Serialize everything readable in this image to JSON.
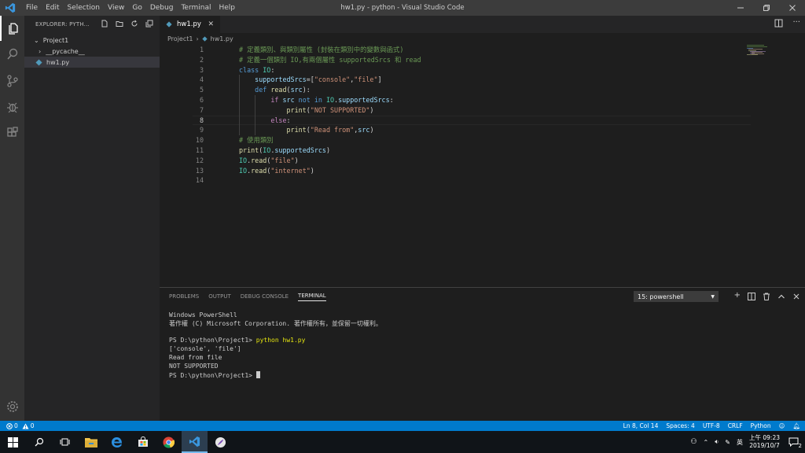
{
  "window": {
    "title": "hw1.py - python - Visual Studio Code",
    "menu": [
      "File",
      "Edit",
      "Selection",
      "View",
      "Go",
      "Debug",
      "Terminal",
      "Help"
    ]
  },
  "sidebar": {
    "header": "EXPLORER: PYTH...",
    "project": "Project1",
    "items": [
      {
        "label": "__pycache__"
      },
      {
        "label": "hw1.py"
      }
    ]
  },
  "editor": {
    "tab_label": "hw1.py",
    "breadcrumb": {
      "folder": "Project1",
      "file": "hw1.py"
    },
    "line_numbers": [
      "1",
      "2",
      "3",
      "4",
      "5",
      "6",
      "7",
      "8",
      "9",
      "10",
      "11",
      "12",
      "13",
      "14"
    ],
    "lines": [
      {
        "tokens": [
          {
            "t": "# 定義類別、與類別屬性 (封裝在類別中的變數與函式)",
            "c": "cm"
          }
        ]
      },
      {
        "tokens": [
          {
            "t": "# 定義一個類別 IO,有兩個屬性 supportedSrcs 和 read",
            "c": "cm"
          }
        ]
      },
      {
        "tokens": [
          {
            "t": "class ",
            "c": "kw"
          },
          {
            "t": "IO",
            "c": "cls"
          },
          {
            "t": ":",
            "c": "pl"
          }
        ]
      },
      {
        "tokens": [
          {
            "t": "    ",
            "c": "pl"
          },
          {
            "t": "supportedSrcs",
            "c": "var"
          },
          {
            "t": "=[",
            "c": "pl"
          },
          {
            "t": "\"console\"",
            "c": "str"
          },
          {
            "t": ",",
            "c": "pl"
          },
          {
            "t": "\"file\"",
            "c": "str"
          },
          {
            "t": "]",
            "c": "pl"
          }
        ]
      },
      {
        "tokens": [
          {
            "t": "    ",
            "c": "pl"
          },
          {
            "t": "def ",
            "c": "kw"
          },
          {
            "t": "read",
            "c": "fn"
          },
          {
            "t": "(",
            "c": "pl"
          },
          {
            "t": "src",
            "c": "var"
          },
          {
            "t": "):",
            "c": "pl"
          }
        ]
      },
      {
        "tokens": [
          {
            "t": "        ",
            "c": "pl"
          },
          {
            "t": "if ",
            "c": "ctl"
          },
          {
            "t": "src ",
            "c": "var"
          },
          {
            "t": "not in ",
            "c": "kw"
          },
          {
            "t": "IO",
            "c": "cls"
          },
          {
            "t": ".",
            "c": "pl"
          },
          {
            "t": "supportedSrcs",
            "c": "var"
          },
          {
            "t": ":",
            "c": "pl"
          }
        ]
      },
      {
        "tokens": [
          {
            "t": "            ",
            "c": "pl"
          },
          {
            "t": "print",
            "c": "fn"
          },
          {
            "t": "(",
            "c": "pl"
          },
          {
            "t": "\"NOT SUPPORTED\"",
            "c": "str"
          },
          {
            "t": ")",
            "c": "pl"
          }
        ]
      },
      {
        "tokens": [
          {
            "t": "        ",
            "c": "pl"
          },
          {
            "t": "else",
            "c": "ctl"
          },
          {
            "t": ":",
            "c": "pl"
          }
        ]
      },
      {
        "tokens": [
          {
            "t": "            ",
            "c": "pl"
          },
          {
            "t": "print",
            "c": "fn"
          },
          {
            "t": "(",
            "c": "pl"
          },
          {
            "t": "\"Read from\"",
            "c": "str"
          },
          {
            "t": ",",
            "c": "pl"
          },
          {
            "t": "src",
            "c": "var"
          },
          {
            "t": ")",
            "c": "pl"
          }
        ]
      },
      {
        "tokens": [
          {
            "t": "# 使用類別",
            "c": "cm"
          }
        ]
      },
      {
        "tokens": [
          {
            "t": "print",
            "c": "fn"
          },
          {
            "t": "(",
            "c": "pl"
          },
          {
            "t": "IO",
            "c": "cls"
          },
          {
            "t": ".",
            "c": "pl"
          },
          {
            "t": "supportedSrcs",
            "c": "var"
          },
          {
            "t": ")",
            "c": "pl"
          }
        ]
      },
      {
        "tokens": [
          {
            "t": "IO",
            "c": "cls"
          },
          {
            "t": ".",
            "c": "pl"
          },
          {
            "t": "read",
            "c": "fn"
          },
          {
            "t": "(",
            "c": "pl"
          },
          {
            "t": "\"file\"",
            "c": "str"
          },
          {
            "t": ")",
            "c": "pl"
          }
        ]
      },
      {
        "tokens": [
          {
            "t": "IO",
            "c": "cls"
          },
          {
            "t": ".",
            "c": "pl"
          },
          {
            "t": "read",
            "c": "fn"
          },
          {
            "t": "(",
            "c": "pl"
          },
          {
            "t": "\"internet\"",
            "c": "str"
          },
          {
            "t": ")",
            "c": "pl"
          }
        ]
      },
      {
        "tokens": []
      }
    ]
  },
  "panel": {
    "tabs": [
      "PROBLEMS",
      "OUTPUT",
      "DEBUG CONSOLE",
      "TERMINAL"
    ],
    "active_tab": "TERMINAL",
    "terminal_select": "15: powershell",
    "terminal": {
      "lines": [
        "Windows PowerShell",
        "著作權 (C) Microsoft Corporation. 著作權所有，並保留一切權利。",
        "",
        "PS D:\\python\\Project1> ",
        "['console', 'file']",
        "Read from file",
        "NOT SUPPORTED",
        "PS D:\\python\\Project1> "
      ],
      "command": "python hw1.py"
    }
  },
  "statusbar": {
    "errors": "0",
    "warnings": "0",
    "position": "Ln 8, Col 14",
    "spaces": "Spaces: 4",
    "encoding": "UTF-8",
    "eol": "CRLF",
    "language": "Python"
  },
  "taskbar": {
    "ime": "英",
    "time": "上午 09:23",
    "date": "2019/10/7",
    "notifications": "2"
  },
  "colors": {
    "accent": "#007acc",
    "comment": "#6a9955",
    "keyword": "#569cd6",
    "string": "#ce9178"
  }
}
